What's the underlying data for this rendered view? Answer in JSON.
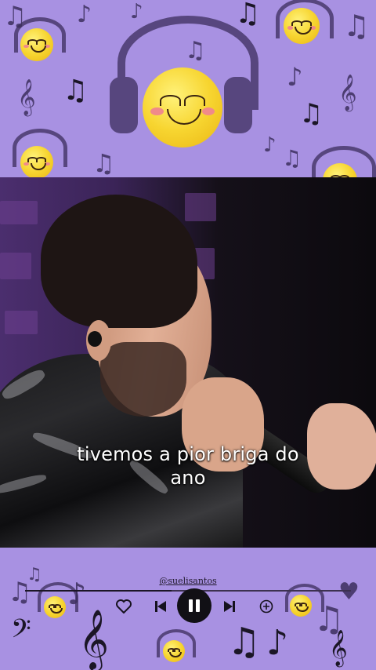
{
  "video": {
    "caption_line1": "tivemos a pior briga do",
    "caption_line2": "ano"
  },
  "player": {
    "handle": "@suelisantos",
    "progress": 0.45,
    "controls": [
      "heart-icon",
      "previous-icon",
      "pause-icon",
      "next-icon",
      "add-icon"
    ]
  },
  "colors": {
    "background_purple": "#a891e2",
    "accent_dark": "#16121e",
    "emoji_yellow": "#f7d530",
    "headphone_purple": "#57467e"
  }
}
